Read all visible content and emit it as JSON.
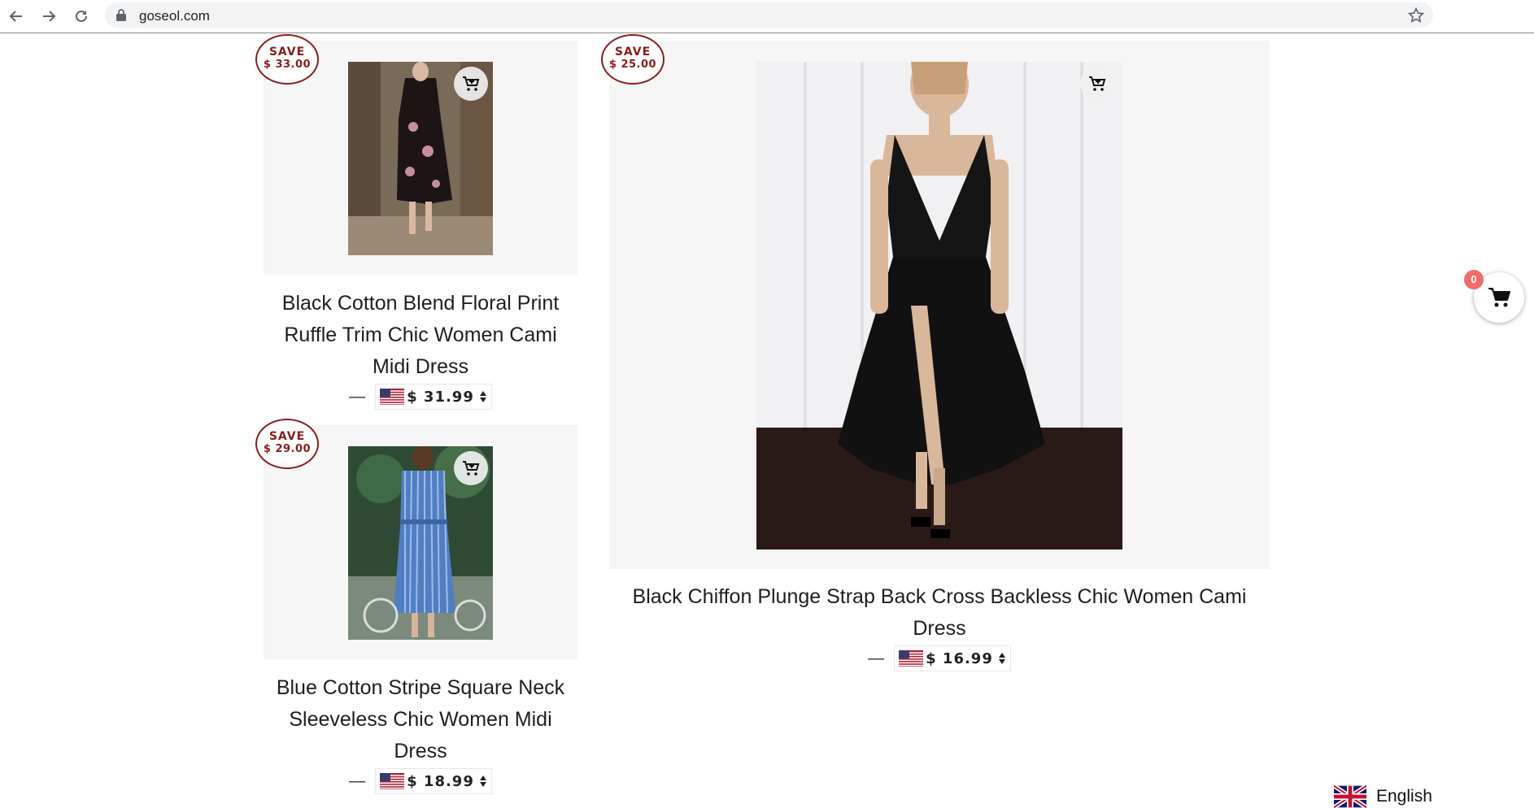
{
  "browser": {
    "url": "goseol.com"
  },
  "products": [
    {
      "save_label": "SAVE",
      "save_amount": "$ 33.00",
      "title": "Black Cotton Blend Floral Print Ruffle Trim Chic Women Cami Midi Dress",
      "price": "$ 31.99",
      "dash": "—",
      "image": "black-floral-midi-dress-photo"
    },
    {
      "save_label": "SAVE",
      "save_amount": "$ 29.00",
      "title": "Blue Cotton Stripe Square Neck Sleeveless Chic Women Midi Dress",
      "price": "$ 18.99",
      "dash": "—",
      "image": "blue-stripe-midi-dress-photo"
    },
    {
      "save_label": "SAVE",
      "save_amount": "$ 25.00",
      "title": "Black Chiffon Plunge Strap Back Cross Backless Chic Women Cami Dress",
      "price": "$ 16.99",
      "dash": "—",
      "image": "black-chiffon-cami-dress-photo"
    }
  ],
  "cart": {
    "count": "0",
    "icon": "shopping-cart-icon"
  },
  "language": {
    "label": "English",
    "flag": "uk-flag-icon"
  },
  "colors": {
    "save_badge": "#8b1c1c",
    "cart_badge": "#f26b6b",
    "card_bg": "#f6f6f6"
  }
}
